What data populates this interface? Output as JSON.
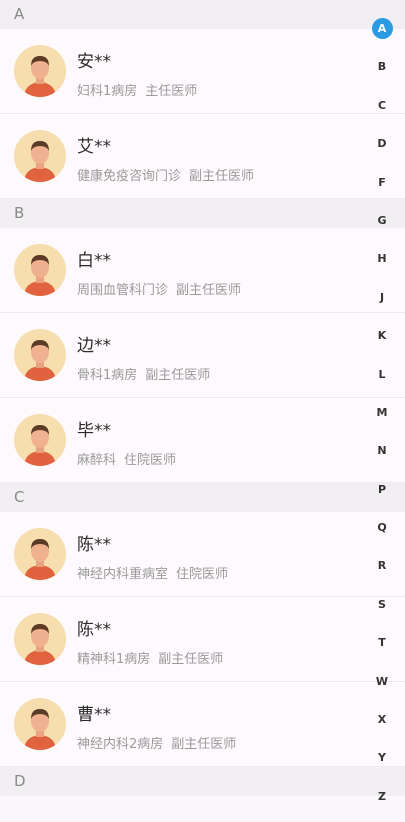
{
  "sections": [
    {
      "letter": "A",
      "contacts": [
        {
          "name": "安**",
          "department": "妇科1病房",
          "title": "主任医师"
        },
        {
          "name": "艾**",
          "department": "健康免疫咨询门诊",
          "title": "副主任医师"
        }
      ]
    },
    {
      "letter": "B",
      "contacts": [
        {
          "name": "白**",
          "department": "周围血管科门诊",
          "title": "副主任医师"
        },
        {
          "name": "边**",
          "department": "骨科1病房",
          "title": "副主任医师"
        },
        {
          "name": "毕**",
          "department": "麻醉科",
          "title": "住院医师"
        }
      ]
    },
    {
      "letter": "C",
      "contacts": [
        {
          "name": "陈**",
          "department": "神经内科重病室",
          "title": "住院医师"
        },
        {
          "name": "陈**",
          "department": "精神科1病房",
          "title": "副主任医师"
        },
        {
          "name": "曹**",
          "department": "神经内科2病房",
          "title": "副主任医师"
        }
      ]
    },
    {
      "letter": "D",
      "contacts": []
    }
  ],
  "index_bar": {
    "letters": [
      "A",
      "B",
      "C",
      "D",
      "F",
      "G",
      "H",
      "J",
      "K",
      "L",
      "M",
      "N",
      "P",
      "Q",
      "R",
      "S",
      "T",
      "W",
      "X",
      "Y",
      "Z"
    ],
    "active": "A",
    "active_color": "#2a9be3"
  },
  "avatar_icon": "doctor-avatar-icon"
}
